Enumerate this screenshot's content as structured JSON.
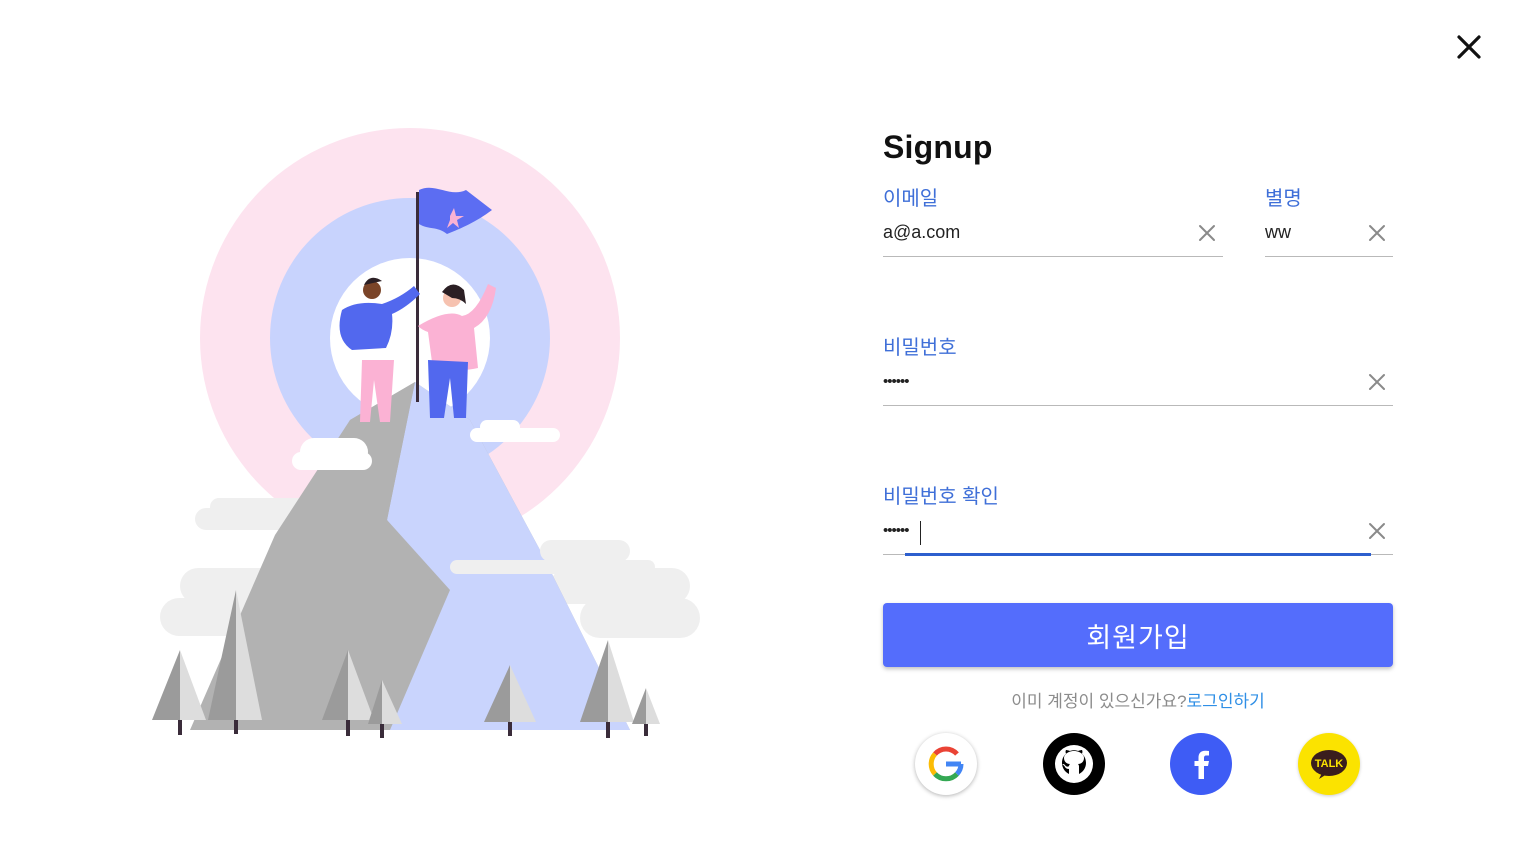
{
  "form": {
    "title": "Signup",
    "email": {
      "label": "이메일",
      "value": "a@a.com"
    },
    "nickname": {
      "label": "별명",
      "value": "ww"
    },
    "password": {
      "label": "비밀번호",
      "value": "••••••"
    },
    "password_confirm": {
      "label": "비밀번호 확인",
      "value": "••••••"
    },
    "submit_label": "회원가입",
    "login_prompt": "이미 계정이 있으신가요?",
    "login_link": "로그인하기"
  },
  "social": [
    "google-icon",
    "github-icon",
    "facebook-icon",
    "kakaotalk-icon"
  ],
  "social_kakao_text": "TALK",
  "colors": {
    "accent": "#546dfc",
    "label": "#3f6fd8",
    "link": "#2f8fe6",
    "facebook": "#3e5cf5",
    "kakao": "#fbe300"
  }
}
